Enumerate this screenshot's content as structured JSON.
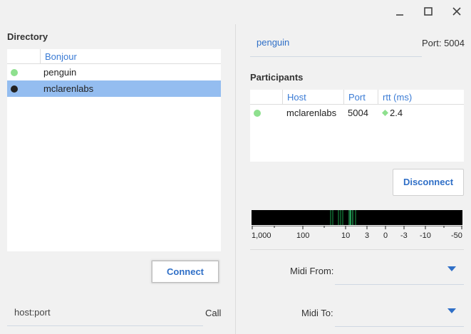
{
  "window": {
    "minimize_icon": "minimize-icon",
    "maximize_icon": "maximize-icon",
    "close_icon": "close-icon"
  },
  "directory": {
    "title": "Directory",
    "column_header": "Bonjour",
    "items": [
      {
        "name": "penguin",
        "status_color": "#8ee08e",
        "selected": false
      },
      {
        "name": "mclarenlabs",
        "status_color": "#222222",
        "selected": true
      }
    ],
    "connect_label": "Connect",
    "address_placeholder": "host:port",
    "call_label": "Call"
  },
  "session": {
    "name": "penguin",
    "port_label": "Port: 5004"
  },
  "participants": {
    "title": "Participants",
    "headers": {
      "host": "Host",
      "port": "Port",
      "rtt": "rtt (ms)"
    },
    "rows": [
      {
        "host": "mclarenlabs",
        "port": "5004",
        "rtt": "2.4",
        "status_color": "#8ee08e",
        "rtt_icon": "diamond-icon"
      }
    ],
    "disconnect_label": "Disconnect"
  },
  "latency_meter": {
    "scale_labels": [
      "1,000",
      "100",
      "10",
      "3",
      "0",
      "-3",
      "-10",
      "-50"
    ]
  },
  "midi": {
    "from_label": "Midi From:",
    "to_label": "Midi To:",
    "from_value": "",
    "to_value": ""
  },
  "colors": {
    "accent": "#3a7bd5",
    "selection": "#94bdf0",
    "meter_bg": "#000000",
    "meter_line": "#2ecc71"
  }
}
